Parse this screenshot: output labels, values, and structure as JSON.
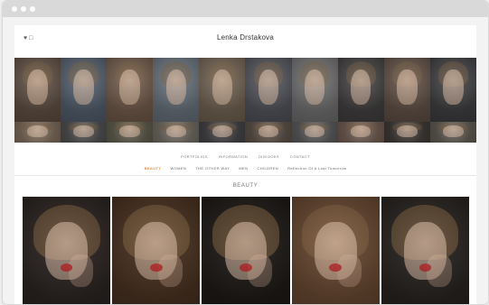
{
  "browser": {
    "title_bar_dots": [
      "dot",
      "dot",
      "dot"
    ]
  },
  "site": {
    "brand": "Lenka Drstakova",
    "top_left_icons": [
      "♥",
      "□"
    ]
  },
  "mosaic": {
    "tiles": [
      {
        "bg": "#5b4b3f"
      },
      {
        "bg": "#4f5967"
      },
      {
        "bg": "#6b5646"
      },
      {
        "bg": "#626b74"
      },
      {
        "bg": "#6a5d4d"
      },
      {
        "bg": "#4d4f55"
      },
      {
        "bg": "#6a6a6a"
      },
      {
        "bg": "#3f3c3c"
      },
      {
        "bg": "#5b4c42"
      },
      {
        "bg": "#3c3b3d"
      },
      {
        "bg": "#7b6a5a"
      },
      {
        "bg": "#4f4f4f"
      },
      {
        "bg": "#5f5b4c"
      },
      {
        "bg": "#6f6a62"
      },
      {
        "bg": "#444245"
      },
      {
        "bg": "#5b5148"
      },
      {
        "bg": "#5a5a5a"
      },
      {
        "bg": "#6f5c52"
      },
      {
        "bg": "#3f3a37"
      },
      {
        "bg": "#5f5b52"
      }
    ]
  },
  "nav_primary": [
    {
      "label": "PORTFOLIOS"
    },
    {
      "label": "INFORMATION"
    },
    {
      "label": "DIGIOOKS"
    },
    {
      "label": "CONTACT"
    }
  ],
  "nav_secondary": [
    {
      "label": "BEAUTY",
      "active": true
    },
    {
      "label": "WOMEN"
    },
    {
      "label": "THE OTHER WAY"
    },
    {
      "label": "MEN"
    },
    {
      "label": "CHILDREN"
    },
    {
      "label": "Reflection Of A Lost Tomorrow"
    }
  ],
  "section": {
    "title": "BEAUTY"
  },
  "gallery": [
    {
      "bg": "#2d2523"
    },
    {
      "bg": "#4b3322"
    },
    {
      "bg": "#1f1b18"
    },
    {
      "bg": "#6a4a33"
    },
    {
      "bg": "#2a2522"
    }
  ]
}
